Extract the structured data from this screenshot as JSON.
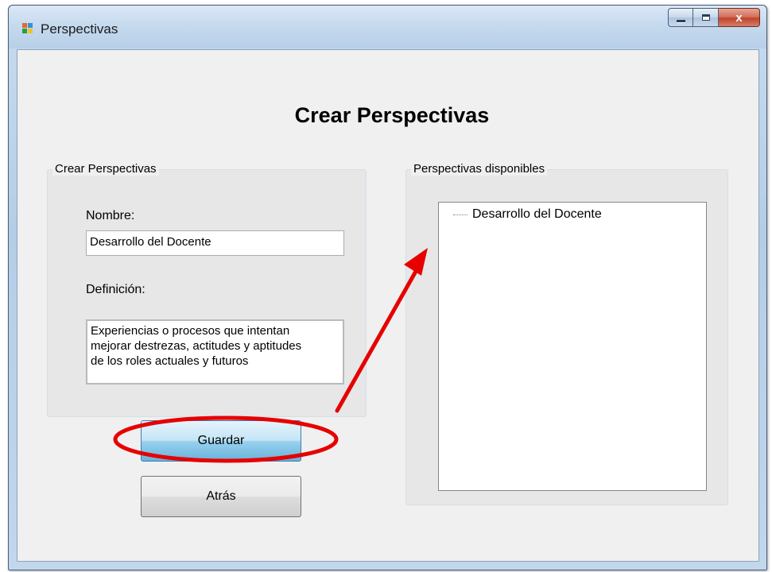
{
  "window": {
    "title": "Perspectivas",
    "buttons": {
      "minimize": "minimize",
      "maximize": "maximize",
      "close": "x"
    }
  },
  "heading": "Crear Perspectivas",
  "create_group": {
    "legend": "Crear Perspectivas",
    "name_label": "Nombre:",
    "name_value": "Desarrollo del Docente",
    "definition_label": "Definición:",
    "definition_value": "Experiencias o procesos que intentan\nmejorar destrezas, actitudes y aptitudes\nde los roles actuales y futuros"
  },
  "available_group": {
    "legend": "Perspectivas disponibles",
    "items": [
      "Desarrollo del Docente"
    ]
  },
  "buttons": {
    "save": "Guardar",
    "back": "Atrás"
  },
  "annotation": {
    "color": "#e60000"
  },
  "icons": {
    "app": "app-windows-icon",
    "minimize": "minimize-icon",
    "maximize": "maximize-icon",
    "close": "close-icon"
  }
}
